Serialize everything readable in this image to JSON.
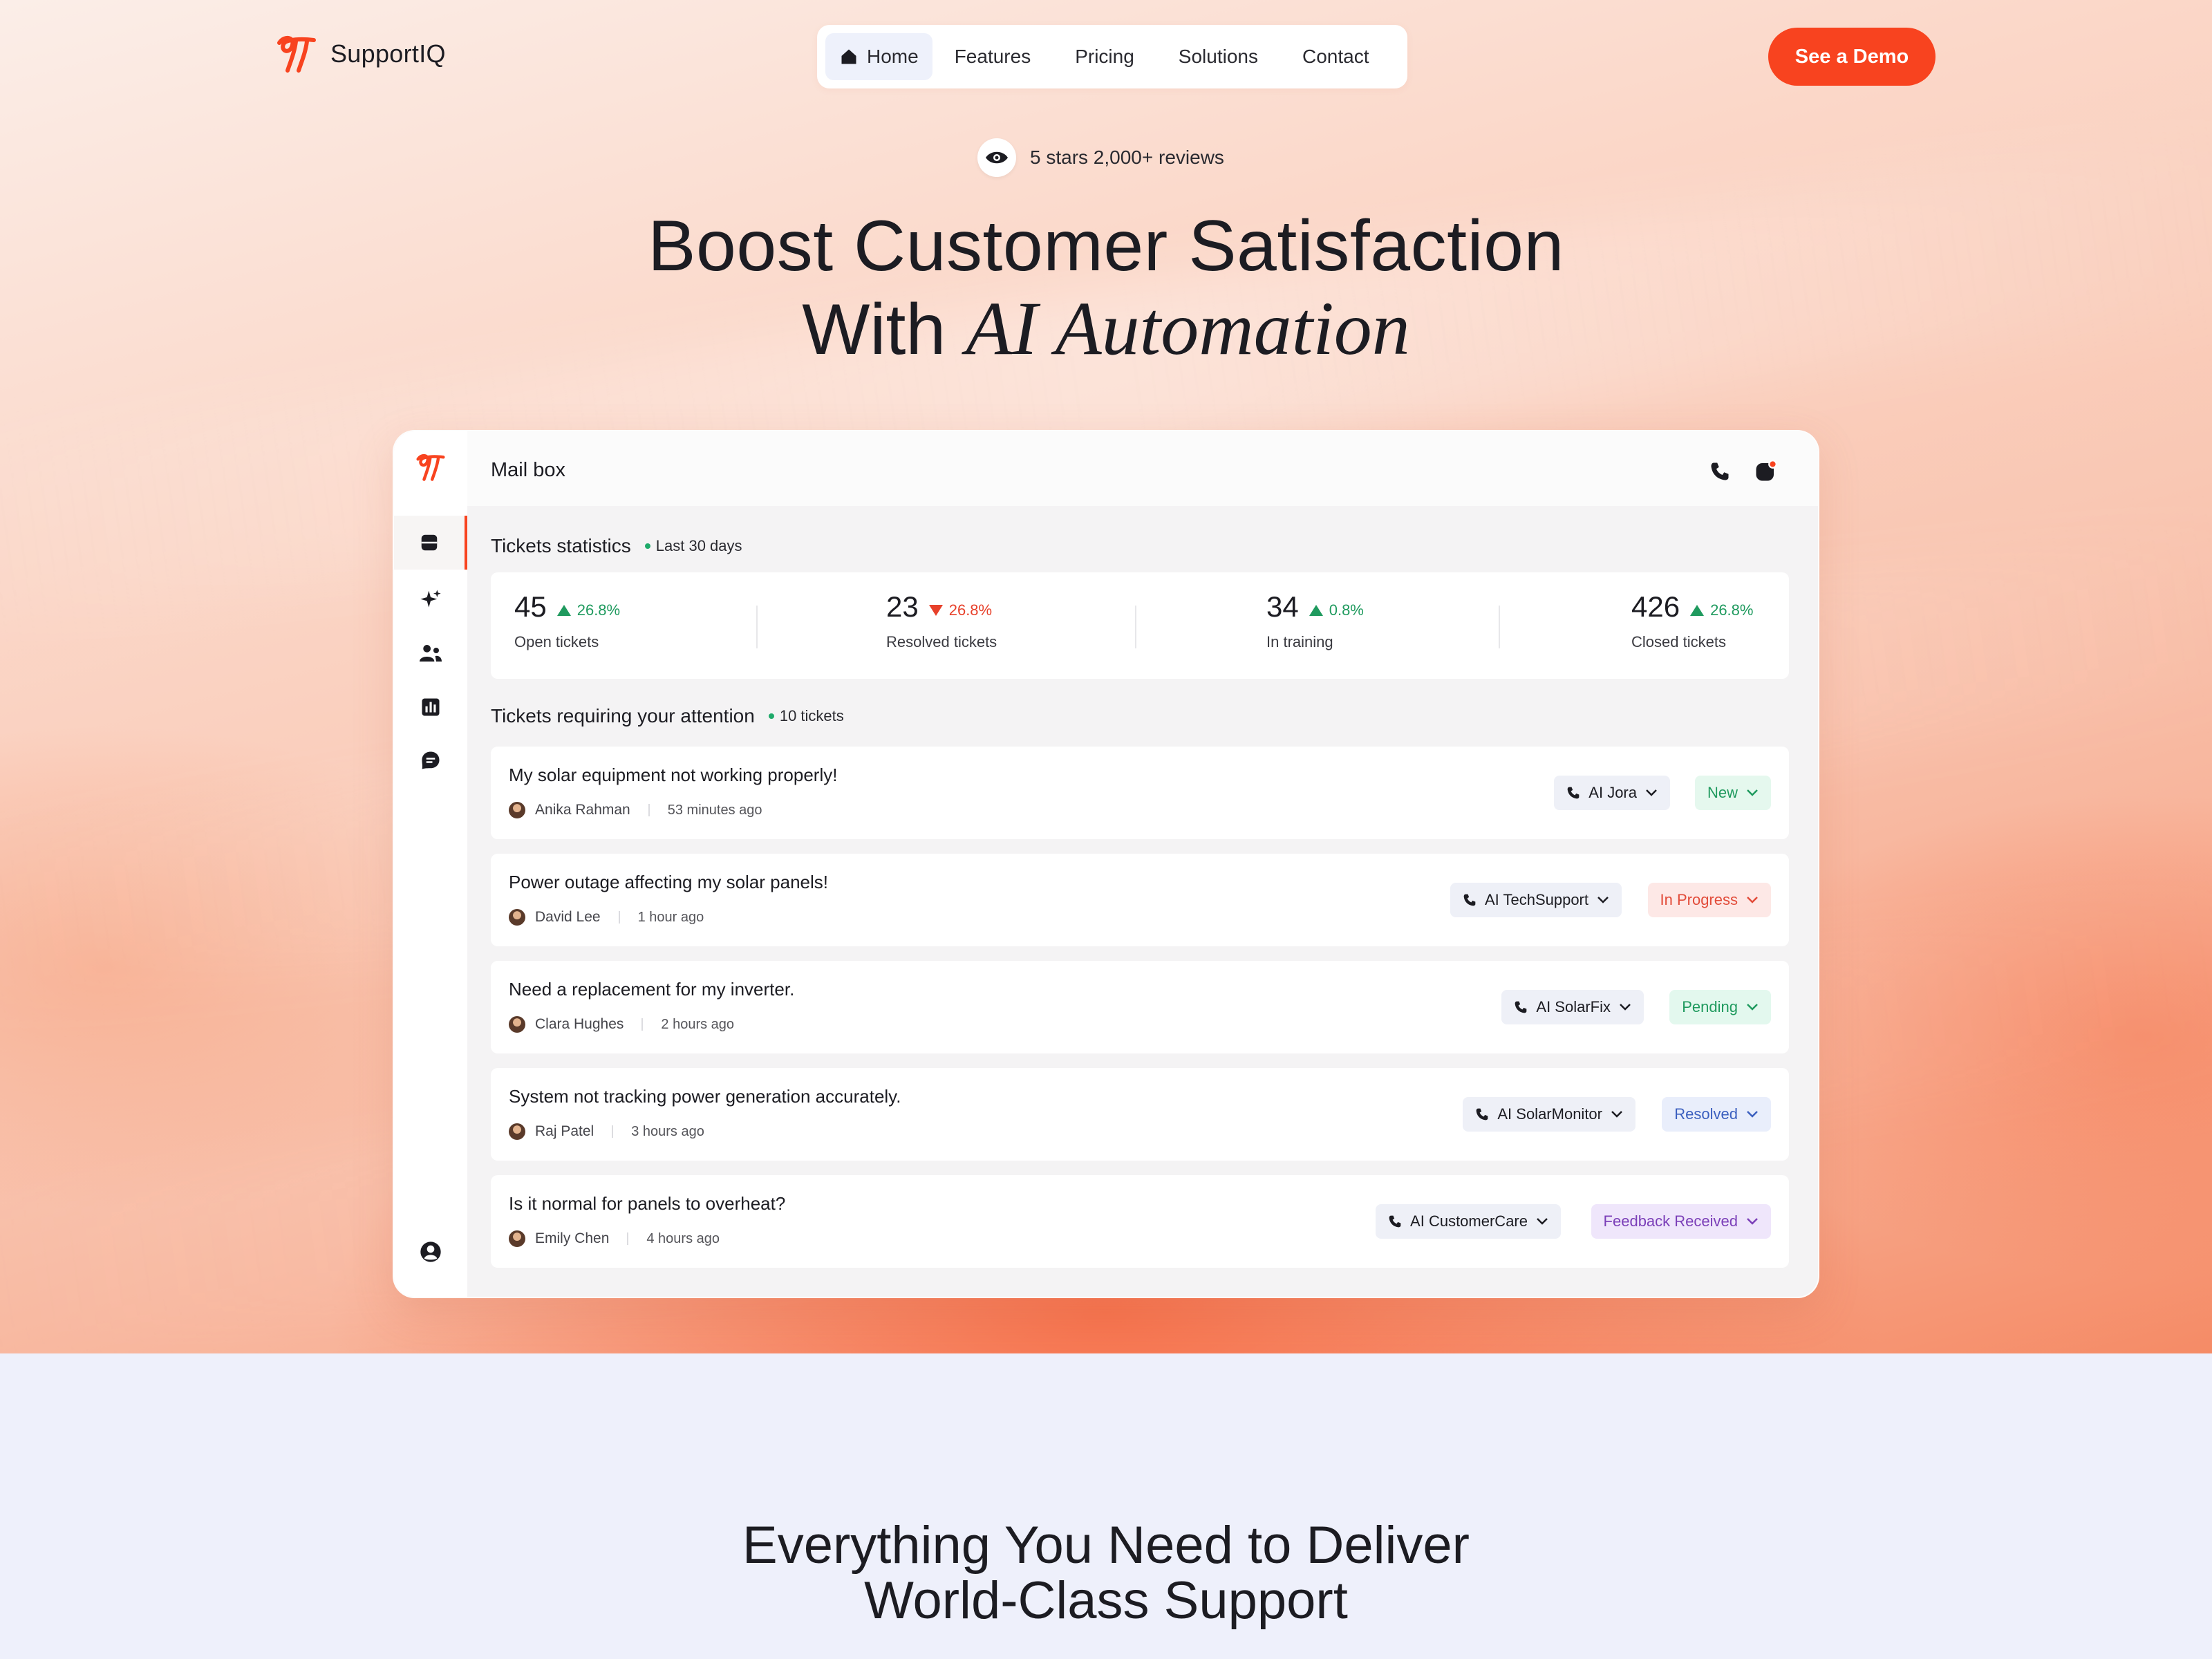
{
  "brand": {
    "name": "SupportIQ",
    "accent": "#f8431f"
  },
  "nav": {
    "items": [
      "Home",
      "Features",
      "Pricing",
      "Solutions",
      "Contact"
    ]
  },
  "cta": {
    "label": "See a Demo"
  },
  "rating": {
    "text": "5 stars 2,000+ reviews"
  },
  "hero": {
    "line1": "Boost Customer Satisfaction",
    "line2_plain": "With",
    "line2_italic": "AI Automation"
  },
  "app": {
    "title": "Mail box",
    "stats_title": "Tickets statistics",
    "stats_period": "Last 30 days",
    "stats": [
      {
        "value": "45",
        "delta": "26.8%",
        "trend": "up",
        "label": "Open tickets"
      },
      {
        "value": "23",
        "delta": "26.8%",
        "trend": "down",
        "label": "Resolved tickets"
      },
      {
        "value": "34",
        "delta": "0.8%",
        "trend": "up",
        "label": "In training"
      },
      {
        "value": "426",
        "delta": "26.8%",
        "trend": "up",
        "label": "Closed tickets"
      }
    ],
    "attention_title": "Tickets requiring your attention",
    "attention_count": "10 tickets",
    "tickets": [
      {
        "subject": "My solar equipment not working properly!",
        "customer": "Anika Rahman",
        "time": "53 minutes ago",
        "agent": "AI Jora",
        "status": "New"
      },
      {
        "subject": "Power outage affecting my solar panels!",
        "customer": "David Lee",
        "time": "1 hour ago",
        "agent": "AI TechSupport",
        "status": "In Progress"
      },
      {
        "subject": "Need a replacement for my inverter.",
        "customer": "Clara Hughes",
        "time": "2 hours ago",
        "agent": "AI SolarFix",
        "status": "Pending"
      },
      {
        "subject": "System not tracking power generation accurately.",
        "customer": "Raj Patel",
        "time": "3 hours ago",
        "agent": "AI SolarMonitor",
        "status": "Resolved"
      },
      {
        "subject": "Is it normal for panels to overheat?",
        "customer": "Emily Chen",
        "time": "4 hours ago",
        "agent": "AI CustomerCare",
        "status": "Feedback Received"
      }
    ]
  },
  "section2": {
    "line1": "Everything You Need to Deliver",
    "line2": "World-Class Support"
  }
}
